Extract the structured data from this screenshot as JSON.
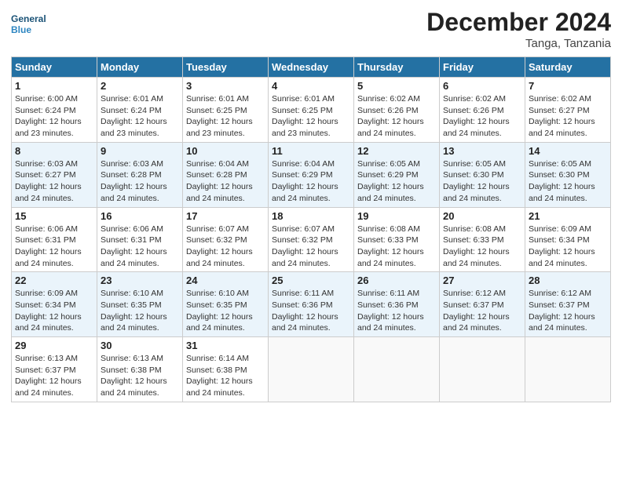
{
  "header": {
    "logo_general": "General",
    "logo_blue": "Blue",
    "month_title": "December 2024",
    "location": "Tanga, Tanzania"
  },
  "calendar": {
    "days_of_week": [
      "Sunday",
      "Monday",
      "Tuesday",
      "Wednesday",
      "Thursday",
      "Friday",
      "Saturday"
    ],
    "weeks": [
      [
        {
          "day": "1",
          "sunrise": "6:00 AM",
          "sunset": "6:24 PM",
          "daylight": "12 hours and 23 minutes."
        },
        {
          "day": "2",
          "sunrise": "6:01 AM",
          "sunset": "6:24 PM",
          "daylight": "12 hours and 23 minutes."
        },
        {
          "day": "3",
          "sunrise": "6:01 AM",
          "sunset": "6:25 PM",
          "daylight": "12 hours and 23 minutes."
        },
        {
          "day": "4",
          "sunrise": "6:01 AM",
          "sunset": "6:25 PM",
          "daylight": "12 hours and 23 minutes."
        },
        {
          "day": "5",
          "sunrise": "6:02 AM",
          "sunset": "6:26 PM",
          "daylight": "12 hours and 24 minutes."
        },
        {
          "day": "6",
          "sunrise": "6:02 AM",
          "sunset": "6:26 PM",
          "daylight": "12 hours and 24 minutes."
        },
        {
          "day": "7",
          "sunrise": "6:02 AM",
          "sunset": "6:27 PM",
          "daylight": "12 hours and 24 minutes."
        }
      ],
      [
        {
          "day": "8",
          "sunrise": "6:03 AM",
          "sunset": "6:27 PM",
          "daylight": "12 hours and 24 minutes."
        },
        {
          "day": "9",
          "sunrise": "6:03 AM",
          "sunset": "6:28 PM",
          "daylight": "12 hours and 24 minutes."
        },
        {
          "day": "10",
          "sunrise": "6:04 AM",
          "sunset": "6:28 PM",
          "daylight": "12 hours and 24 minutes."
        },
        {
          "day": "11",
          "sunrise": "6:04 AM",
          "sunset": "6:29 PM",
          "daylight": "12 hours and 24 minutes."
        },
        {
          "day": "12",
          "sunrise": "6:05 AM",
          "sunset": "6:29 PM",
          "daylight": "12 hours and 24 minutes."
        },
        {
          "day": "13",
          "sunrise": "6:05 AM",
          "sunset": "6:30 PM",
          "daylight": "12 hours and 24 minutes."
        },
        {
          "day": "14",
          "sunrise": "6:05 AM",
          "sunset": "6:30 PM",
          "daylight": "12 hours and 24 minutes."
        }
      ],
      [
        {
          "day": "15",
          "sunrise": "6:06 AM",
          "sunset": "6:31 PM",
          "daylight": "12 hours and 24 minutes."
        },
        {
          "day": "16",
          "sunrise": "6:06 AM",
          "sunset": "6:31 PM",
          "daylight": "12 hours and 24 minutes."
        },
        {
          "day": "17",
          "sunrise": "6:07 AM",
          "sunset": "6:32 PM",
          "daylight": "12 hours and 24 minutes."
        },
        {
          "day": "18",
          "sunrise": "6:07 AM",
          "sunset": "6:32 PM",
          "daylight": "12 hours and 24 minutes."
        },
        {
          "day": "19",
          "sunrise": "6:08 AM",
          "sunset": "6:33 PM",
          "daylight": "12 hours and 24 minutes."
        },
        {
          "day": "20",
          "sunrise": "6:08 AM",
          "sunset": "6:33 PM",
          "daylight": "12 hours and 24 minutes."
        },
        {
          "day": "21",
          "sunrise": "6:09 AM",
          "sunset": "6:34 PM",
          "daylight": "12 hours and 24 minutes."
        }
      ],
      [
        {
          "day": "22",
          "sunrise": "6:09 AM",
          "sunset": "6:34 PM",
          "daylight": "12 hours and 24 minutes."
        },
        {
          "day": "23",
          "sunrise": "6:10 AM",
          "sunset": "6:35 PM",
          "daylight": "12 hours and 24 minutes."
        },
        {
          "day": "24",
          "sunrise": "6:10 AM",
          "sunset": "6:35 PM",
          "daylight": "12 hours and 24 minutes."
        },
        {
          "day": "25",
          "sunrise": "6:11 AM",
          "sunset": "6:36 PM",
          "daylight": "12 hours and 24 minutes."
        },
        {
          "day": "26",
          "sunrise": "6:11 AM",
          "sunset": "6:36 PM",
          "daylight": "12 hours and 24 minutes."
        },
        {
          "day": "27",
          "sunrise": "6:12 AM",
          "sunset": "6:37 PM",
          "daylight": "12 hours and 24 minutes."
        },
        {
          "day": "28",
          "sunrise": "6:12 AM",
          "sunset": "6:37 PM",
          "daylight": "12 hours and 24 minutes."
        }
      ],
      [
        {
          "day": "29",
          "sunrise": "6:13 AM",
          "sunset": "6:37 PM",
          "daylight": "12 hours and 24 minutes."
        },
        {
          "day": "30",
          "sunrise": "6:13 AM",
          "sunset": "6:38 PM",
          "daylight": "12 hours and 24 minutes."
        },
        {
          "day": "31",
          "sunrise": "6:14 AM",
          "sunset": "6:38 PM",
          "daylight": "12 hours and 24 minutes."
        },
        null,
        null,
        null,
        null
      ]
    ]
  }
}
